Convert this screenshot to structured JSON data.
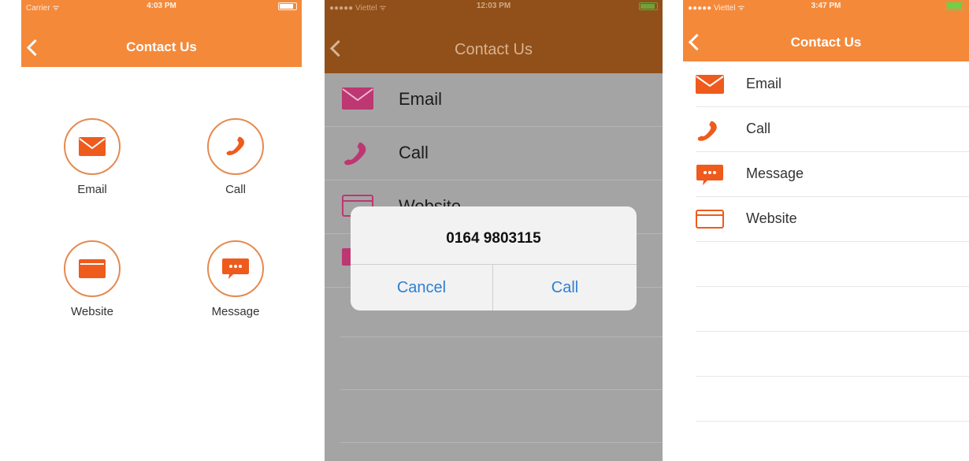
{
  "screen1": {
    "status": {
      "carrier": "Carrier ᯤ",
      "time": "4:03 PM"
    },
    "nav": {
      "title": "Contact Us"
    },
    "grid": [
      {
        "label": "Email",
        "icon": "envelope-icon"
      },
      {
        "label": "Call",
        "icon": "phone-icon"
      },
      {
        "label": "Website",
        "icon": "browser-icon"
      },
      {
        "label": "Message",
        "icon": "chat-bubble-icon"
      }
    ],
    "colors": {
      "accent": "#f4893a",
      "icon": "#ee5b1d"
    }
  },
  "screen2": {
    "status": {
      "carrier": "●●●●● Viettel ᯤ",
      "time": "12:03 PM"
    },
    "nav": {
      "title": "Contact Us"
    },
    "list": [
      {
        "label": "Email",
        "icon": "envelope-icon"
      },
      {
        "label": "Call",
        "icon": "phone-icon"
      },
      {
        "label": "Website",
        "icon": "browser-icon"
      }
    ],
    "dialog": {
      "number": "0164 9803115",
      "cancel": "Cancel",
      "call": "Call"
    },
    "colors": {
      "nav": "#915019",
      "overlay": "#a4a4a4",
      "icon": "#c2256a",
      "link": "#2f7fd1"
    }
  },
  "screen3": {
    "status": {
      "carrier": "●●●●● Viettel ᯤ",
      "time": "3:47 PM"
    },
    "nav": {
      "title": "Contact Us"
    },
    "list": [
      {
        "label": "Email",
        "icon": "envelope-icon"
      },
      {
        "label": "Call",
        "icon": "phone-icon"
      },
      {
        "label": "Message",
        "icon": "chat-bubble-icon"
      },
      {
        "label": "Website",
        "icon": "browser-icon"
      }
    ],
    "colors": {
      "accent": "#f4893a",
      "icon": "#ee5b1d"
    }
  }
}
